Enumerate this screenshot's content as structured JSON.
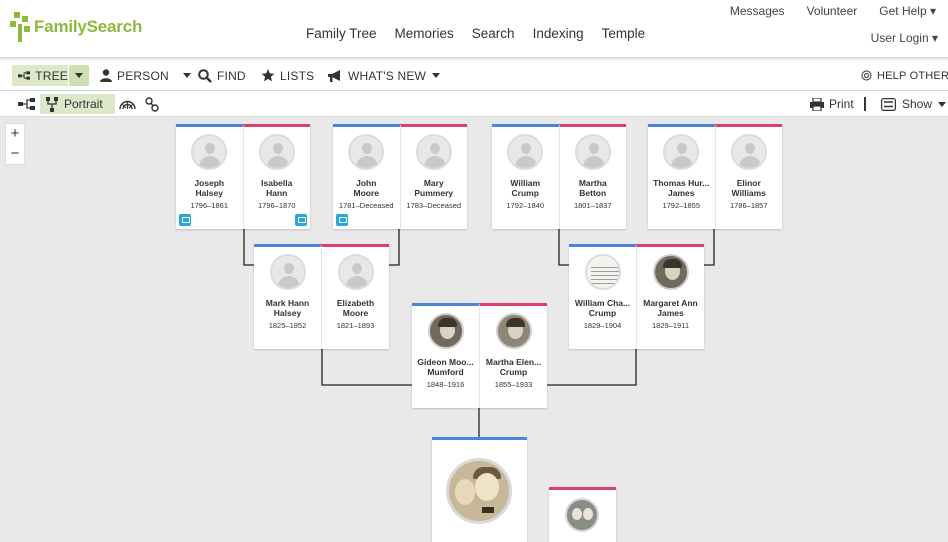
{
  "brand": {
    "name": "FamilySearch",
    "color": "#8cba3f"
  },
  "header": {
    "main_nav": [
      "Family Tree",
      "Memories",
      "Search",
      "Indexing",
      "Temple"
    ],
    "util_nav": [
      "Messages",
      "Volunteer",
      "Get Help ▾"
    ],
    "user_login": "User Login ▾"
  },
  "toolbar": {
    "tree": "TREE",
    "person": "PERSON",
    "find": "FIND",
    "lists": "LISTS",
    "whats_new": "WHAT'S NEW",
    "help_others": "HELP OTHERS"
  },
  "subbar": {
    "portrait": "Portrait",
    "print": "Print",
    "show": "Show"
  },
  "zoom": {
    "in": "+",
    "out": "−"
  },
  "colors": {
    "male": "#4d86d9",
    "female": "#db3f6b",
    "background": "#e9e9e9",
    "active": "#dde8c9"
  },
  "tree": {
    "gen3": [
      {
        "husband": {
          "name1": "Joseph",
          "name2": "Halsey",
          "dates": "1796–1861"
        },
        "wife": {
          "name1": "Isabella",
          "name2": "Hann",
          "dates": "1796–1870"
        }
      },
      {
        "husband": {
          "name1": "John",
          "name2": "Moore",
          "dates": "1781–Deceased"
        },
        "wife": {
          "name1": "Mary",
          "name2": "Pummery",
          "dates": "1783–Deceased"
        }
      },
      {
        "husband": {
          "name1": "William",
          "name2": "Crump",
          "dates": "1792–1840"
        },
        "wife": {
          "name1": "Martha",
          "name2": "Betton",
          "dates": "1801–1837"
        }
      },
      {
        "husband": {
          "name1": "Thomas Hur...",
          "name2": "James",
          "dates": "1792–1855"
        },
        "wife": {
          "name1": "Elinor",
          "name2": "Williams",
          "dates": "1786–1857"
        }
      }
    ],
    "gen2": [
      {
        "husband": {
          "name1": "Mark Hann",
          "name2": "Halsey",
          "dates": "1825–1852"
        },
        "wife": {
          "name1": "Elizabeth",
          "name2": "Moore",
          "dates": "1821–1893"
        }
      },
      {
        "husband": {
          "name1": "William Cha...",
          "name2": "Crump",
          "dates": "1829–1904"
        },
        "wife": {
          "name1": "Margaret Ann",
          "name2": "James",
          "dates": "1829–1911"
        }
      }
    ],
    "gen1": {
      "husband": {
        "name1": "Gideon Moo...",
        "name2": "Mumford",
        "dates": "1848–1916"
      },
      "wife": {
        "name1": "Martha Elen...",
        "name2": "Crump",
        "dates": "1855–1933"
      }
    }
  }
}
